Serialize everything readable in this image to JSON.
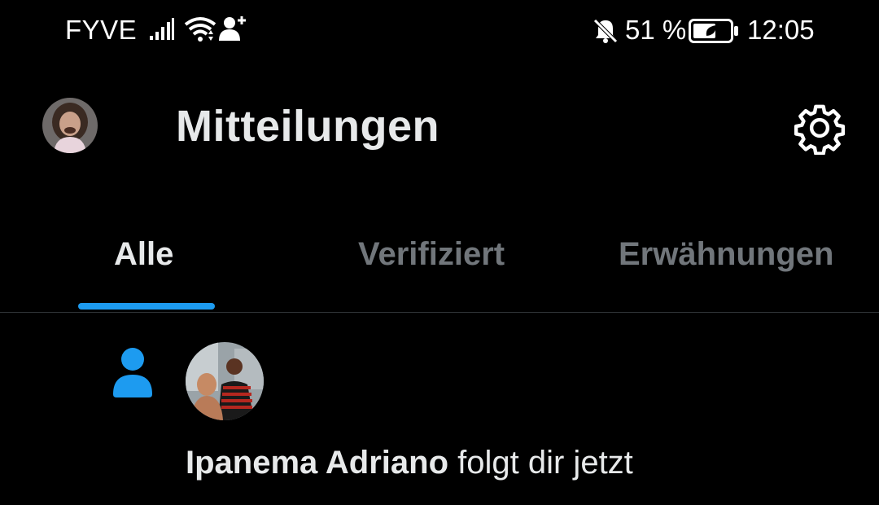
{
  "status_bar": {
    "carrier": "FYVE",
    "battery_percent": "51 %",
    "time": "12:05"
  },
  "header": {
    "title": "Mitteilungen"
  },
  "tabs": [
    {
      "label": "Alle",
      "active": true
    },
    {
      "label": "Verifiziert",
      "active": false
    },
    {
      "label": "Erwähnungen",
      "active": false
    }
  ],
  "notifications": [
    {
      "user": "Ipanema Adriano",
      "action": " folgt dir jetzt"
    }
  ],
  "colors": {
    "accent": "#1d9bf0",
    "background": "#000000",
    "text": "#e7e9ea",
    "muted": "#71767b"
  }
}
